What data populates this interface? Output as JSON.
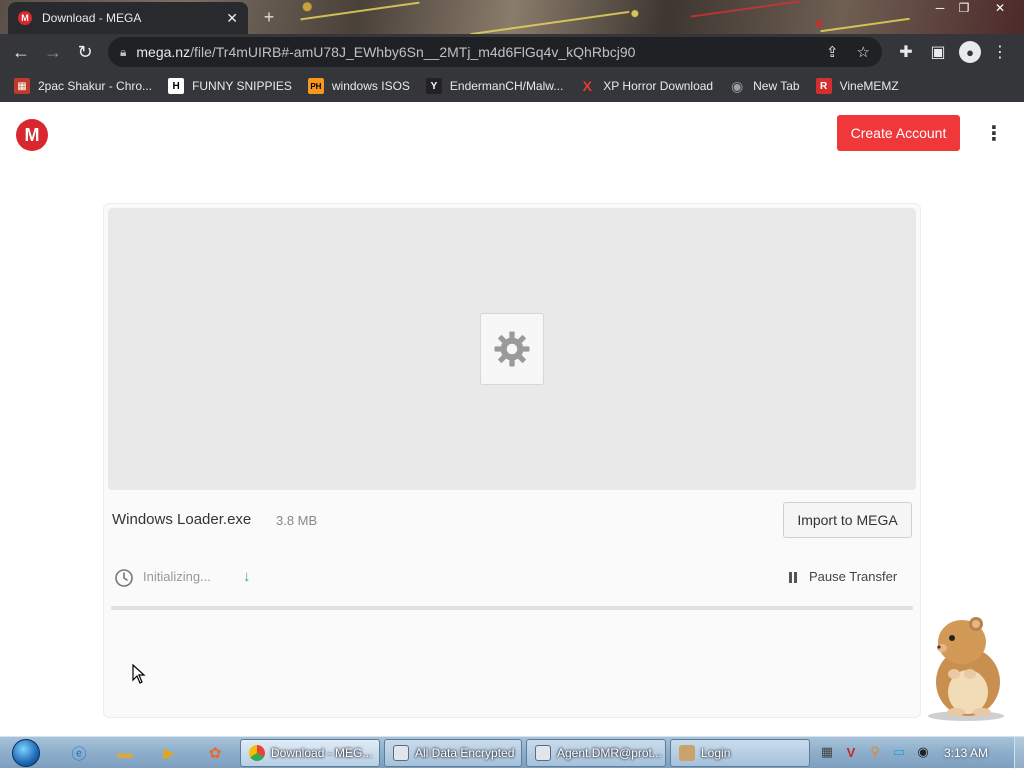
{
  "browser": {
    "tab_title": "Download - MEGA",
    "tab_favicon": "M",
    "url_host": "mega.nz",
    "url_path": "/file/Tr4mUIRB#-amU78J_EWhby6Sn__2MTj_m4d6FlGq4v_kQhRbcj90",
    "bookmarks": [
      {
        "label": "2pac Shakur - Chro...",
        "icon": "calendar-icon",
        "badge": "▦",
        "color": "#c0392b"
      },
      {
        "label": "FUNNY SNIPPIES",
        "icon": "h-logo-icon",
        "badge": "H",
        "color": "#ffffff"
      },
      {
        "label": "windows ISOS",
        "icon": "ph-logo-icon",
        "badge": "PH",
        "color": "#f7971d"
      },
      {
        "label": "EndermanCH/Malw...",
        "icon": "yp-logo-icon",
        "badge": "Y",
        "color": "#222222"
      },
      {
        "label": "XP Horror Download",
        "icon": "x-logo-icon",
        "badge": "X",
        "color": "#e53935"
      },
      {
        "label": "New Tab",
        "icon": "globe-icon",
        "badge": "◉",
        "color": "#9aa0a6"
      },
      {
        "label": "VineMEMZ",
        "icon": "r-logo-icon",
        "badge": "R",
        "color": "#d32f2f"
      }
    ]
  },
  "page": {
    "logo": "M",
    "create_account": "Create Account",
    "more_menu": "⋮",
    "file": {
      "name": "Windows Loader.exe",
      "size": "3.8 MB",
      "import_label": "Import to MEGA",
      "status": "Initializing...",
      "pause_label": "Pause Transfer",
      "progress": 0
    }
  },
  "taskbar": {
    "pinned": [
      "ie-icon",
      "explorer-folder-icon",
      "media-player-icon",
      "paint-icon"
    ],
    "tasks": [
      {
        "label": "Download - MEG...",
        "icon": "chrome-icon",
        "active": true
      },
      {
        "label": "All Data Encrypted",
        "icon": "window-icon",
        "active": false
      },
      {
        "label": "Agent.DMR@prot...",
        "icon": "window-icon",
        "active": false
      },
      {
        "label": "Login",
        "icon": "user-icon",
        "active": false
      }
    ],
    "clock": "3:13 AM"
  },
  "colors": {
    "mega_red": "#d9272e",
    "create_button": "#f0373a",
    "progress_green": "#29b67d"
  }
}
